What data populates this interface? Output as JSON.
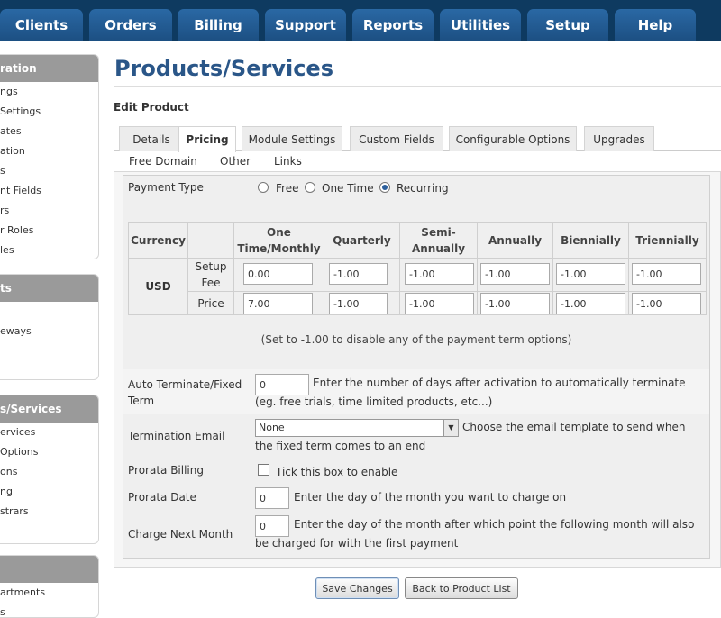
{
  "nav": {
    "tabs": [
      "Clients",
      "Orders",
      "Billing",
      "Support",
      "Reports",
      "Utilities",
      "Setup",
      "Help"
    ]
  },
  "sidebar": {
    "sections": [
      {
        "header": "ration",
        "items": [
          "ngs",
          "Settings",
          "ates",
          "ation",
          "s",
          "nt Fields",
          "rs",
          "r Roles",
          "les"
        ]
      },
      {
        "header": "ts",
        "items": [
          "",
          "eways"
        ]
      },
      {
        "header": "s/Services",
        "items": [
          "ervices",
          " Options",
          "ons",
          "ng",
          "strars"
        ]
      },
      {
        "header": "",
        "items": [
          "artments",
          "s"
        ]
      }
    ]
  },
  "page": {
    "title": "Products/Services",
    "subtitle": "Edit Product"
  },
  "tabs": [
    "Details",
    "Pricing",
    "Module Settings",
    "Custom Fields",
    "Configurable Options",
    "Upgrades"
  ],
  "subtabs": [
    "Free Domain",
    "Other",
    "Links"
  ],
  "form": {
    "payment_type": {
      "label": "Payment Type",
      "options": [
        "Free",
        "One Time",
        "Recurring"
      ],
      "selected": "Recurring"
    },
    "pricing": {
      "headers": [
        "Currency",
        "",
        "One Time/Monthly",
        "Quarterly",
        "Semi-Annually",
        "Annually",
        "Biennially",
        "Triennially"
      ],
      "currency": "USD",
      "rows": [
        {
          "label": "Setup Fee",
          "values": [
            "0.00",
            "-1.00",
            "-1.00",
            "-1.00",
            "-1.00",
            "-1.00"
          ]
        },
        {
          "label": "Price",
          "values": [
            "7.00",
            "-1.00",
            "-1.00",
            "-1.00",
            "-1.00",
            "-1.00"
          ]
        }
      ],
      "note": "(Set to -1.00 to disable any of the payment term options)"
    },
    "auto_terminate": {
      "label": "Auto Terminate/Fixed Term",
      "value": "0",
      "help": "Enter the number of days after activation to automatically terminate (eg. free trials, time limited products, etc...)"
    },
    "termination_email": {
      "label": "Termination Email",
      "value": "None",
      "help": "Choose the email template to send when the fixed term comes to an end"
    },
    "prorata_billing": {
      "label": "Prorata Billing",
      "help": "Tick this box to enable"
    },
    "prorata_date": {
      "label": "Prorata Date",
      "value": "0",
      "help": "Enter the day of the month you want to charge on"
    },
    "charge_next_month": {
      "label": "Charge Next Month",
      "value": "0",
      "help": "Enter the day of the month after which point the following month will also be charged for with the first payment"
    }
  },
  "buttons": {
    "save": "Save Changes",
    "back": "Back to Product List"
  }
}
